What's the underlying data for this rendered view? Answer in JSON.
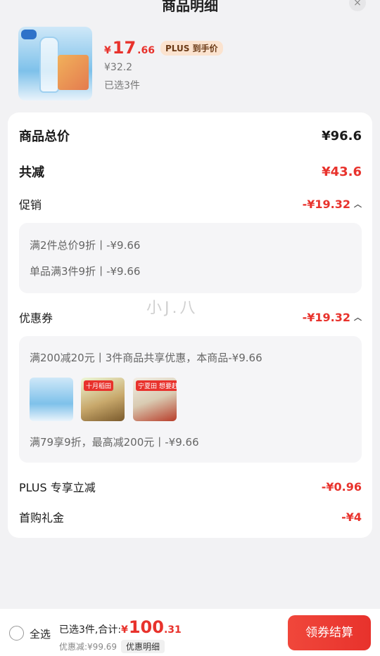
{
  "header": {
    "title": "商品明细",
    "close_glyph": "×"
  },
  "product": {
    "currency": "¥",
    "price_int": "17",
    "price_dec": ".66",
    "plus_badge": "PLUS 到手价",
    "original_price": "¥32.2",
    "selected": "已选3件"
  },
  "summary": {
    "total_label": "商品总价",
    "total_value": "¥96.6",
    "reduce_label": "共减",
    "reduce_value": "¥43.6",
    "promo": {
      "label": "促销",
      "value": "-¥19.32",
      "items": [
        "满2件总价9折丨-¥9.66",
        "单品满3件9折丨-¥9.66"
      ]
    },
    "coupon": {
      "label": "优惠券",
      "value": "-¥19.32",
      "line1": "满200减20元丨3件商品共享优惠，本商品-¥9.66",
      "thumb_tags": [
        "",
        "十月稻田",
        "宁夏田 想要赶"
      ],
      "line2": "满79享9折，最高减200元丨-¥9.66"
    },
    "plus": {
      "label": "PLUS 专享立减",
      "value": "-¥0.96"
    },
    "first": {
      "label": "首购礼金",
      "value": "-¥4"
    }
  },
  "watermark": "小J.八",
  "footer": {
    "select_all": "全选",
    "summary_prefix": "已选3件,合计:",
    "currency": "¥",
    "total_int": "100",
    "total_dec": ".31",
    "discount_text": "优惠减:¥99.69",
    "detail_label": "优惠明细",
    "checkout_label": "领券结算"
  },
  "colors": {
    "accent": "#e8322c",
    "background": "#f2f2f4"
  }
}
